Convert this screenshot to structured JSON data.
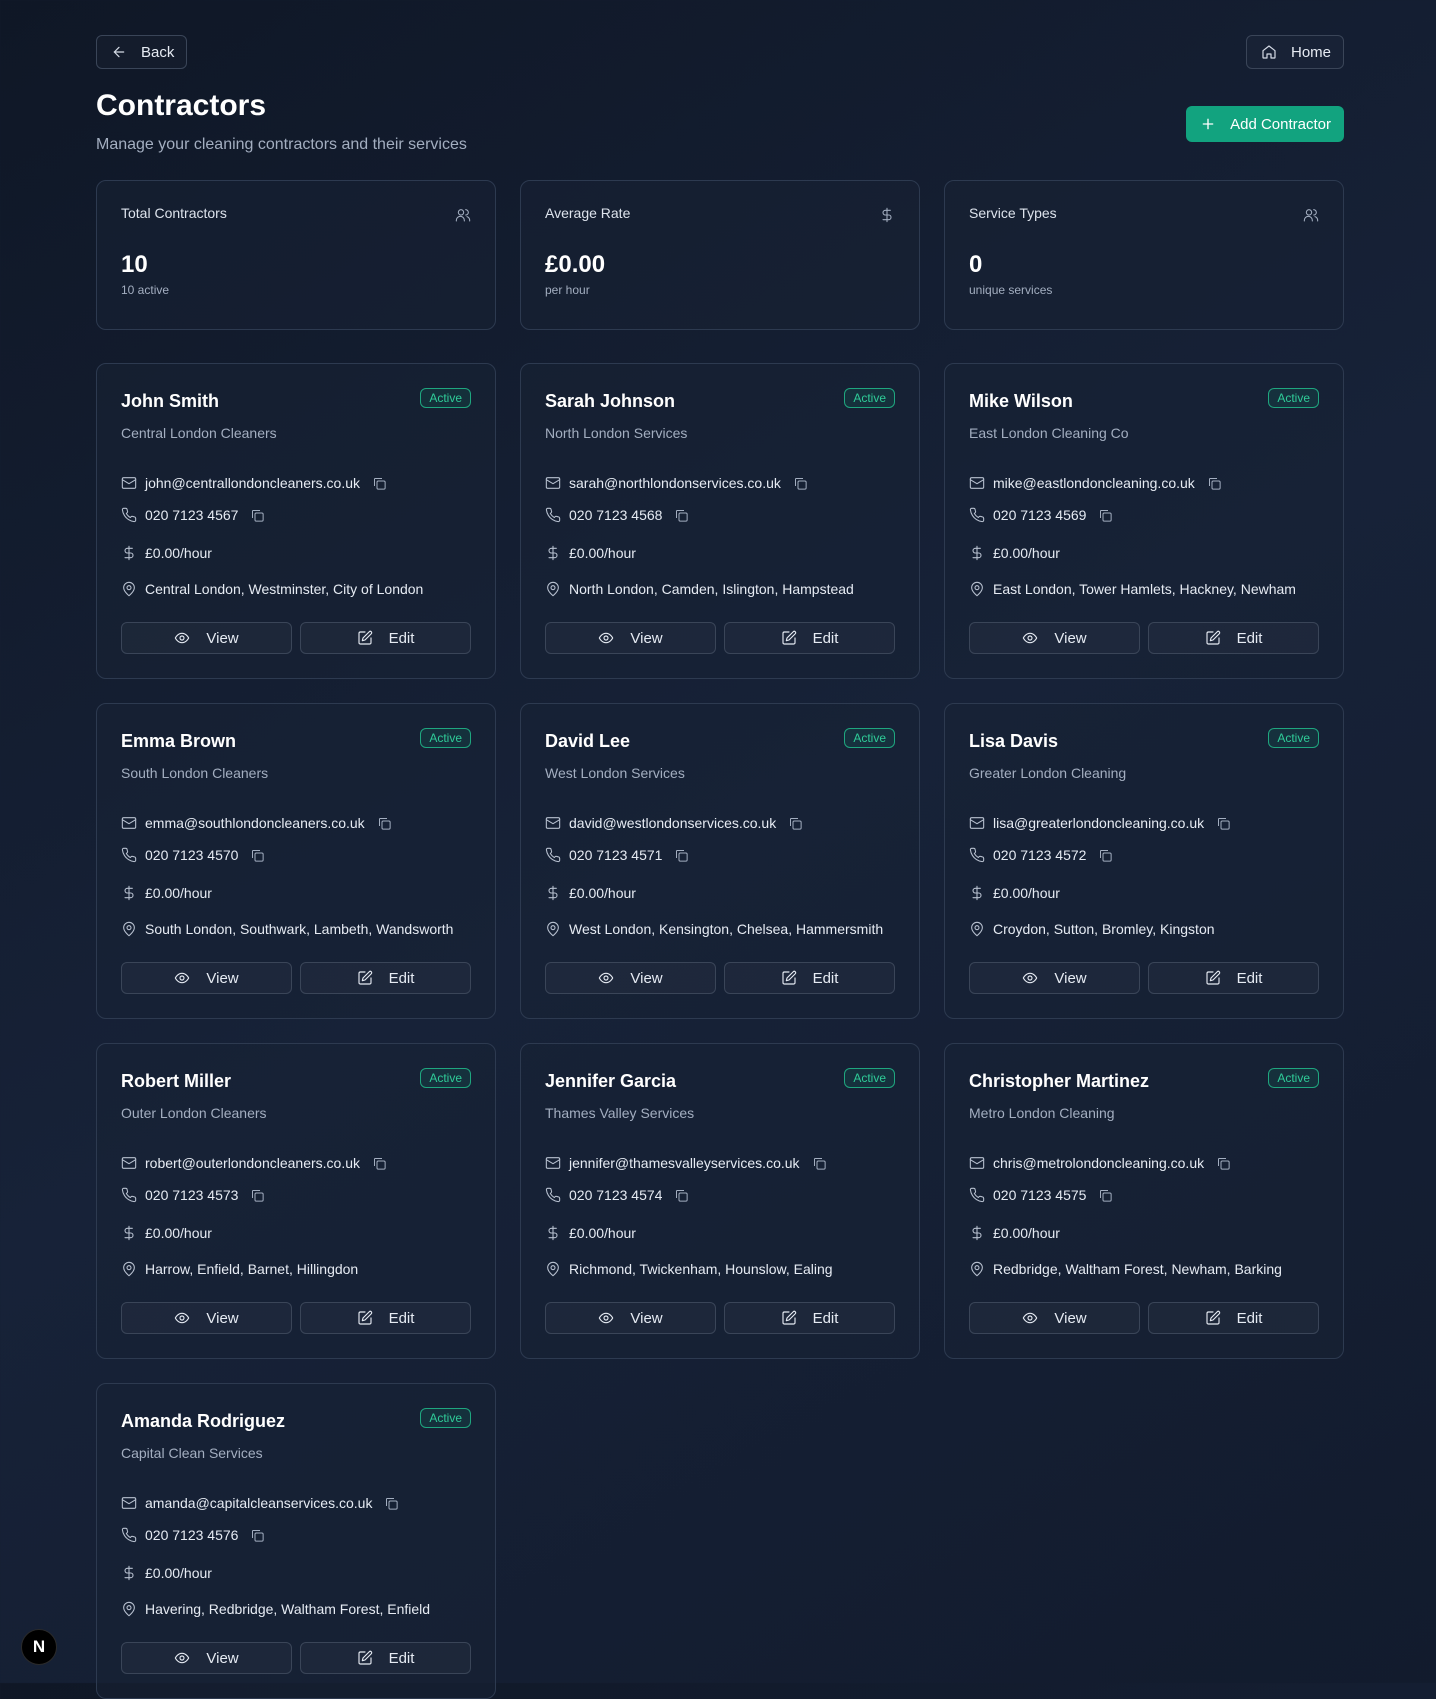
{
  "nav": {
    "back_label": "Back",
    "home_label": "Home"
  },
  "header": {
    "title": "Contractors",
    "subtitle": "Manage your cleaning contractors and their services",
    "add_label": "Add Contractor"
  },
  "stats": [
    {
      "label": "Total Contractors",
      "value": "10",
      "sub": "10 active",
      "icon": "users-icon"
    },
    {
      "label": "Average Rate",
      "value": "£0.00",
      "sub": "per hour",
      "icon": "dollar-icon"
    },
    {
      "label": "Service Types",
      "value": "0",
      "sub": "unique services",
      "icon": "users-icon"
    }
  ],
  "card_actions": {
    "view_label": "View",
    "edit_label": "Edit"
  },
  "contractors": [
    {
      "name": "John Smith",
      "company": "Central London Cleaners",
      "status": "Active",
      "email": "john@centrallondoncleaners.co.uk",
      "phone": "020 7123 4567",
      "rate": "£0.00/hour",
      "areas": "Central London, Westminster, City of London"
    },
    {
      "name": "Sarah Johnson",
      "company": "North London Services",
      "status": "Active",
      "email": "sarah@northlondonservices.co.uk",
      "phone": "020 7123 4568",
      "rate": "£0.00/hour",
      "areas": "North London, Camden, Islington, Hampstead"
    },
    {
      "name": "Mike Wilson",
      "company": "East London Cleaning Co",
      "status": "Active",
      "email": "mike@eastlondoncleaning.co.uk",
      "phone": "020 7123 4569",
      "rate": "£0.00/hour",
      "areas": "East London, Tower Hamlets, Hackney, Newham"
    },
    {
      "name": "Emma Brown",
      "company": "South London Cleaners",
      "status": "Active",
      "email": "emma@southlondoncleaners.co.uk",
      "phone": "020 7123 4570",
      "rate": "£0.00/hour",
      "areas": "South London, Southwark, Lambeth, Wandsworth"
    },
    {
      "name": "David Lee",
      "company": "West London Services",
      "status": "Active",
      "email": "david@westlondonservices.co.uk",
      "phone": "020 7123 4571",
      "rate": "£0.00/hour",
      "areas": "West London, Kensington, Chelsea, Hammersmith"
    },
    {
      "name": "Lisa Davis",
      "company": "Greater London Cleaning",
      "status": "Active",
      "email": "lisa@greaterlondoncleaning.co.uk",
      "phone": "020 7123 4572",
      "rate": "£0.00/hour",
      "areas": "Croydon, Sutton, Bromley, Kingston"
    },
    {
      "name": "Robert Miller",
      "company": "Outer London Cleaners",
      "status": "Active",
      "email": "robert@outerlondoncleaners.co.uk",
      "phone": "020 7123 4573",
      "rate": "£0.00/hour",
      "areas": "Harrow, Enfield, Barnet, Hillingdon"
    },
    {
      "name": "Jennifer Garcia",
      "company": "Thames Valley Services",
      "status": "Active",
      "email": "jennifer@thamesvalleyservices.co.uk",
      "phone": "020 7123 4574",
      "rate": "£0.00/hour",
      "areas": "Richmond, Twickenham, Hounslow, Ealing"
    },
    {
      "name": "Christopher Martinez",
      "company": "Metro London Cleaning",
      "status": "Active",
      "email": "chris@metrolondoncleaning.co.uk",
      "phone": "020 7123 4575",
      "rate": "£0.00/hour",
      "areas": "Redbridge, Waltham Forest, Newham, Barking"
    },
    {
      "name": "Amanda Rodriguez",
      "company": "Capital Clean Services",
      "status": "Active",
      "email": "amanda@capitalcleanservices.co.uk",
      "phone": "020 7123 4576",
      "rate": "£0.00/hour",
      "areas": "Havering, Redbridge, Waltham Forest, Enfield"
    }
  ],
  "dev_badge": "N"
}
